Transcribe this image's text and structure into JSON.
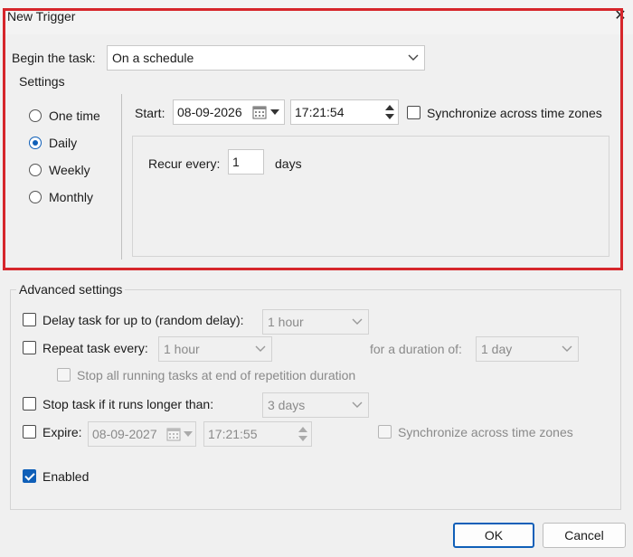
{
  "window": {
    "title": "New Trigger",
    "close_icon": "close-icon"
  },
  "begin": {
    "label": "Begin the task:",
    "value": "On a schedule"
  },
  "settings": {
    "group_label": "Settings",
    "radios": [
      {
        "label": "One time",
        "checked": false
      },
      {
        "label": "Daily",
        "checked": true
      },
      {
        "label": "Weekly",
        "checked": false
      },
      {
        "label": "Monthly",
        "checked": false
      }
    ],
    "start_label": "Start:",
    "start_date": "08-09-2026",
    "start_time": "17:21:54",
    "sync_label": "Synchronize across time zones",
    "recur_label": "Recur every:",
    "recur_value": "1",
    "recur_unit": "days"
  },
  "advanced": {
    "group_label": "Advanced settings",
    "delay_label": "Delay task for up to (random delay):",
    "delay_value": "1 hour",
    "repeat_label": "Repeat task every:",
    "repeat_value": "1 hour",
    "duration_label": "for a duration of:",
    "duration_value": "1 day",
    "stop_running_label": "Stop all running tasks at end of repetition duration",
    "stop_longer_label": "Stop task if it runs longer than:",
    "stop_longer_value": "3 days",
    "expire_label": "Expire:",
    "expire_date": "08-09-2027",
    "expire_time": "17:21:55",
    "expire_sync_label": "Synchronize across time zones",
    "enabled_label": "Enabled"
  },
  "buttons": {
    "ok": "OK",
    "cancel": "Cancel"
  },
  "colors": {
    "accent": "#0f5fb8",
    "highlight": "#d6262b"
  }
}
